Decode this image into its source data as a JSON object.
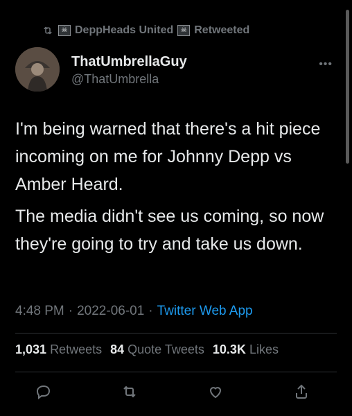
{
  "retweeted_by": {
    "name": "DeppHeads United",
    "suffix": "Retweeted",
    "flag_glyph": "☠"
  },
  "author": {
    "name": "ThatUmbrellaGuy",
    "handle": "@ThatUmbrella"
  },
  "tweet": {
    "paragraph1": "I'm being warned that there's a hit piece incoming on me for Johnny Depp vs Amber Heard.",
    "paragraph2": "The media didn't see us coming, so now they're going to try and take us down."
  },
  "meta": {
    "time": "4:48 PM",
    "date": "2022-06-01",
    "separator": "·",
    "app": "Twitter Web App"
  },
  "stats": {
    "retweets_count": "1,031",
    "retweets_label": "Retweets",
    "quotes_count": "84",
    "quotes_label": "Quote Tweets",
    "likes_count": "10.3K",
    "likes_label": "Likes"
  },
  "colors": {
    "background": "#000000",
    "text": "#e7e9ea",
    "muted": "#71767b",
    "link": "#1d9bf0",
    "divider": "#2f3336"
  },
  "icons": [
    "retweet-icon",
    "more-icon",
    "reply-icon",
    "retweet-action-icon",
    "like-icon",
    "share-icon"
  ]
}
